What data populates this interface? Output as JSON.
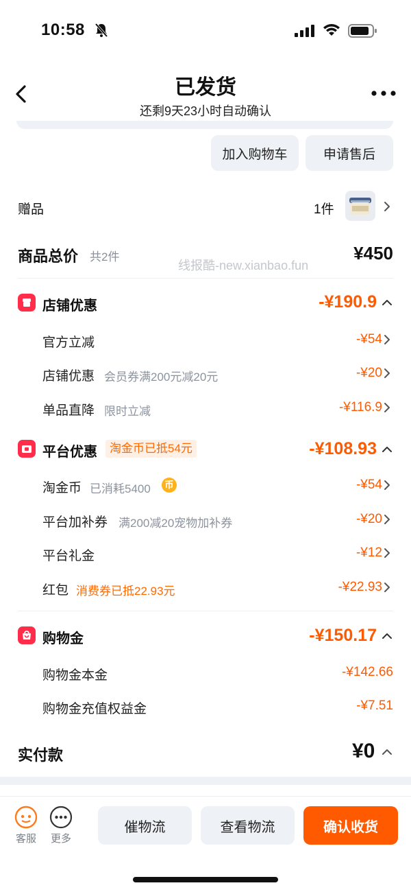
{
  "status": {
    "time": "10:58"
  },
  "header": {
    "title": "已发货",
    "subtitle": "还剩9天23小时自动确认"
  },
  "actions": {
    "add_cart": "加入购物车",
    "after_sale": "申请售后"
  },
  "gift": {
    "label": "赠品",
    "count": "1件"
  },
  "total": {
    "label": "商品总价",
    "count": "共2件",
    "price": "¥450"
  },
  "watermark": "线报酷-new.xianbao.fun",
  "shop_discount": {
    "title": "店铺优惠",
    "amount": "-¥190.9",
    "items": [
      {
        "label": "官方立减",
        "note": "",
        "amount": "-¥54"
      },
      {
        "label": "店铺优惠",
        "note": "会员券满200元减20元",
        "amount": "-¥20"
      },
      {
        "label": "单品直降",
        "note": "限时立减",
        "amount": "-¥116.9"
      }
    ]
  },
  "platform_discount": {
    "title": "平台优惠",
    "badge": "淘金币已抵54元",
    "amount": "-¥108.93",
    "items": [
      {
        "label": "淘金币",
        "note": "已消耗5400",
        "coin": "币",
        "amount": "-¥54"
      },
      {
        "label": "平台加补券",
        "note": "满200减20宠物加补券",
        "amount": "-¥20"
      },
      {
        "label": "平台礼金",
        "note": "",
        "amount": "-¥12"
      },
      {
        "label": "红包",
        "note": "消费券已抵22.93元",
        "amount": "-¥22.93"
      }
    ]
  },
  "shopping_money": {
    "title": "购物金",
    "amount": "-¥150.17",
    "items": [
      {
        "label": "购物金本金",
        "amount": "-¥142.66"
      },
      {
        "label": "购物金充值权益金",
        "amount": "-¥7.51"
      }
    ]
  },
  "paid": {
    "label": "实付款",
    "amount": "¥0"
  },
  "bottom": {
    "service": "客服",
    "more": "更多",
    "urge": "催物流",
    "view_logistics": "查看物流",
    "confirm": "确认收货"
  },
  "colors": {
    "accent": "#ff5a00",
    "badge_red": "#ff2d4a"
  }
}
